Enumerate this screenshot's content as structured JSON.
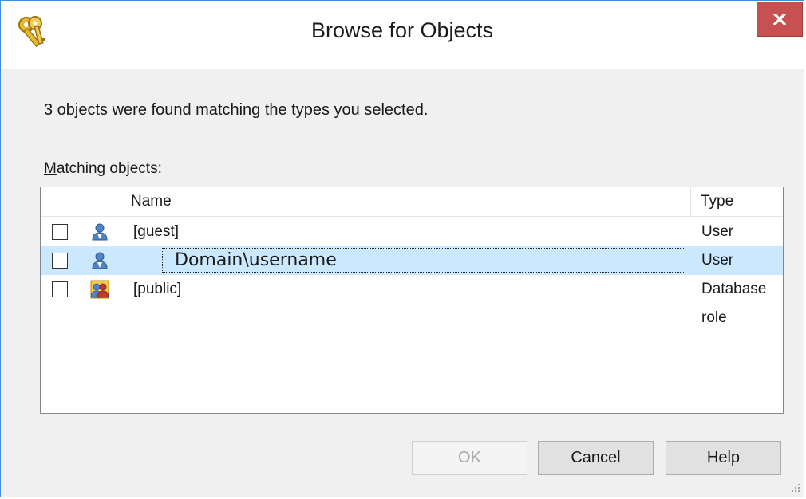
{
  "window": {
    "title": "Browse for Objects",
    "close_label": "x"
  },
  "info_text": "3 objects were found matching the types you selected.",
  "list": {
    "label_mnemonic": "M",
    "label_rest": "atching objects:",
    "columns": {
      "name": "Name",
      "type": "Type"
    },
    "rows": [
      {
        "name": "[guest]",
        "type": "User",
        "icon": "user-icon",
        "checked": false,
        "selected": false
      },
      {
        "name": "Domain\\username",
        "type": "User",
        "icon": "user-icon",
        "checked": false,
        "selected": true
      },
      {
        "name": "[public]",
        "type": "Database role",
        "icon": "role-icon",
        "checked": false,
        "selected": false
      }
    ]
  },
  "buttons": {
    "ok": "OK",
    "cancel": "Cancel",
    "help": "Help"
  },
  "colors": {
    "title_bar": "#ffffff",
    "close_button": "#c75050",
    "selection": "#cce8ff",
    "window_border": "#3c8fd8"
  }
}
